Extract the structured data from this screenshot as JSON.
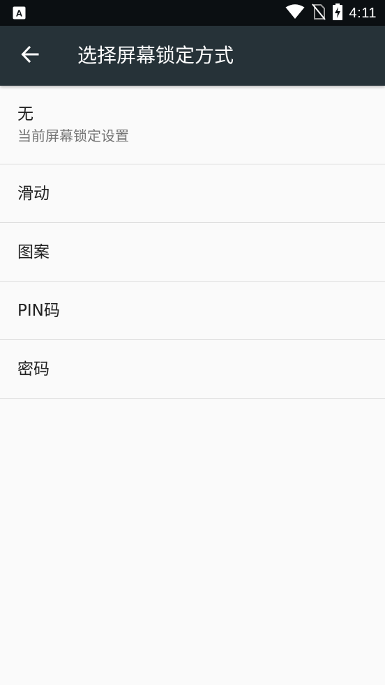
{
  "status_bar": {
    "time": "4:11",
    "icons": [
      "a-notification-icon",
      "wifi-icon",
      "no-sim-icon",
      "battery-charging-icon"
    ],
    "notification_letter": "A"
  },
  "app_bar": {
    "title": "选择屏幕锁定方式",
    "back_icon": "arrow-back-icon"
  },
  "options": [
    {
      "title": "无",
      "subtitle": "当前屏幕锁定设置"
    },
    {
      "title": "滑动"
    },
    {
      "title": "图案"
    },
    {
      "title": "PIN码"
    },
    {
      "title": "密码"
    }
  ],
  "colors": {
    "status_bar_bg": "#0b0f12",
    "app_bar_bg": "#263238",
    "page_bg": "#fafafa",
    "divider": "#dcdcdc",
    "primary_text": "#212121",
    "secondary_text": "#757575"
  }
}
